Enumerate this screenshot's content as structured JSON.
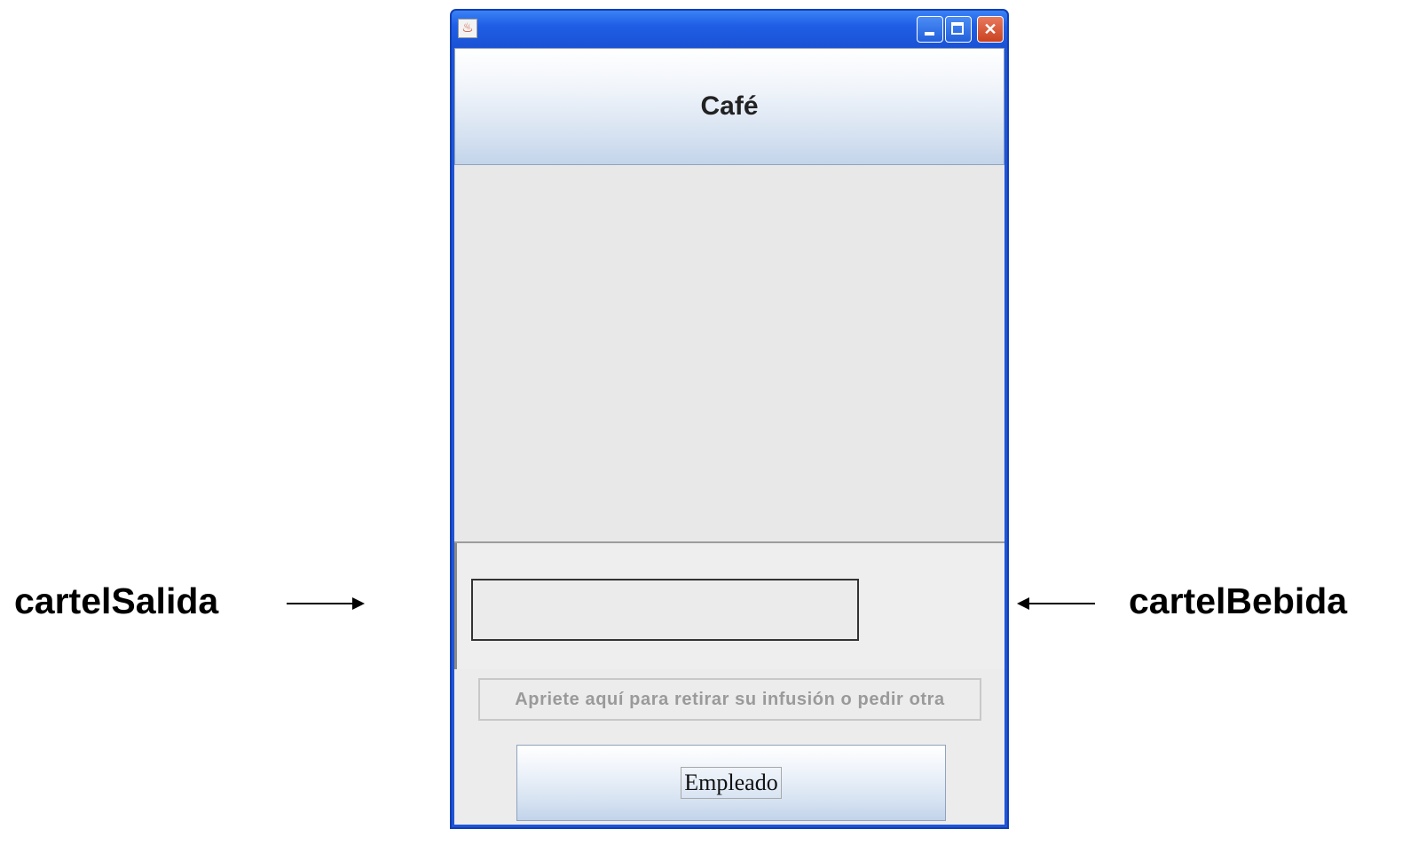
{
  "annotations": {
    "left_label": "cartelSalida",
    "right_label": "cartelBebida"
  },
  "window": {
    "title": "",
    "icon": "java-icon",
    "controls": [
      "minimize-icon",
      "maximize-icon",
      "close-icon"
    ]
  },
  "header": {
    "label": "Café"
  },
  "cartel_salida": {
    "value": ""
  },
  "retirar_button": {
    "label": "Apriete aquí para retirar su infusión o pedir otra",
    "enabled": false
  },
  "empleado_button": {
    "label": "Empleado"
  }
}
